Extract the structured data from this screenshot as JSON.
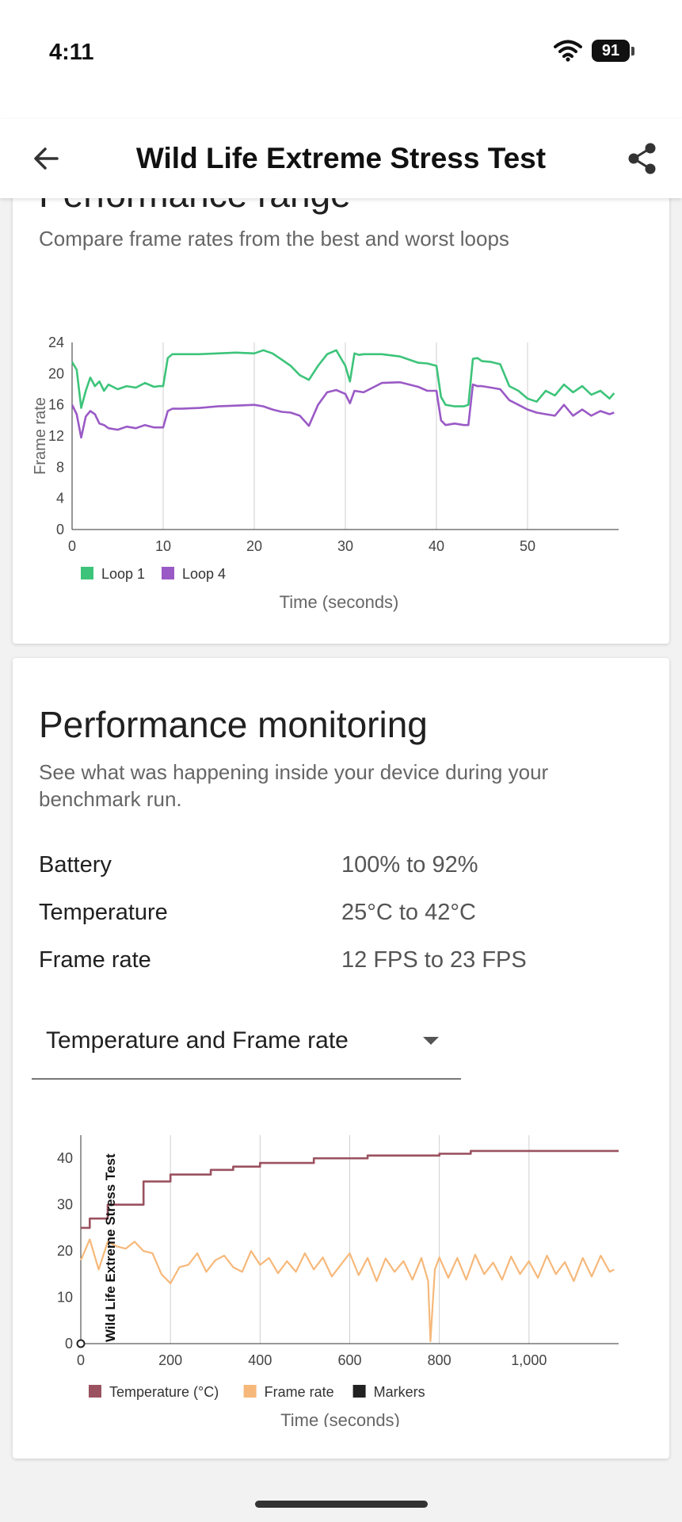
{
  "status_bar": {
    "time": "4:11",
    "battery": "91"
  },
  "app_bar": {
    "title": "Wild Life Extreme Stress Test"
  },
  "range_card": {
    "heading": "Performance range",
    "subtitle": "Compare frame rates from the best and worst loops"
  },
  "monitor_card": {
    "heading": "Performance monitoring",
    "subtitle": "See what was happening inside your device during your benchmark run.",
    "stats": [
      {
        "label": "Battery",
        "value": "100% to 92%"
      },
      {
        "label": "Temperature",
        "value": "25°C to 42°C"
      },
      {
        "label": "Frame rate",
        "value": "12 FPS to 23 FPS"
      }
    ],
    "dropdown": {
      "selected": "Temperature and Frame rate"
    }
  },
  "colors": {
    "loop1": "#3dc47a",
    "loop4": "#9a5ac6",
    "temperature": "#9b5260",
    "frame_rate": "#f6b87a",
    "markers": "#222222"
  },
  "chart_data": [
    {
      "type": "line",
      "xlabel": "Time (seconds)",
      "ylabel": "Frame rate",
      "xlim": [
        0,
        60
      ],
      "ylim": [
        0,
        24
      ],
      "x_ticks": [
        "0",
        "10",
        "20",
        "30",
        "40",
        "50"
      ],
      "y_ticks": [
        "0",
        "4",
        "8",
        "12",
        "16",
        "20",
        "24"
      ],
      "grid": "vertical",
      "legend": "bottom-left",
      "series": [
        {
          "name": "Loop 1",
          "x": [
            0,
            0.5,
            1,
            1.5,
            2,
            2.5,
            3,
            3.5,
            4,
            5,
            6,
            7,
            8,
            9,
            9.5,
            10,
            10.5,
            11,
            12,
            14,
            16,
            18,
            20,
            21,
            22,
            23,
            24,
            25,
            26,
            27,
            28,
            29,
            30,
            30.5,
            31,
            31.5,
            32,
            34,
            36,
            38,
            39,
            40,
            40.5,
            41,
            42,
            43,
            43.5,
            44,
            44.5,
            45,
            46,
            47,
            48,
            49,
            50,
            51,
            52,
            53,
            54,
            55,
            56,
            57,
            58,
            59,
            59.5
          ],
          "values": [
            21.5,
            20.5,
            15.6,
            17.8,
            19.5,
            18.4,
            19.0,
            17.8,
            18.6,
            18.0,
            18.4,
            18.2,
            18.8,
            18.3,
            18.4,
            18.4,
            22.0,
            22.5,
            22.5,
            22.5,
            22.6,
            22.7,
            22.6,
            23.0,
            22.6,
            21.8,
            21.0,
            19.8,
            19.2,
            21.0,
            22.5,
            23.0,
            21.0,
            19.0,
            22.6,
            22.4,
            22.5,
            22.5,
            22.2,
            21.4,
            21.3,
            21.0,
            17.0,
            16.0,
            15.8,
            15.8,
            16.0,
            21.9,
            22.0,
            21.6,
            21.5,
            21.2,
            18.4,
            17.8,
            16.8,
            16.4,
            17.8,
            17.2,
            18.6,
            17.6,
            18.4,
            17.3,
            17.8,
            16.8,
            17.5
          ]
        },
        {
          "name": "Loop 4",
          "x": [
            0,
            0.5,
            1,
            1.5,
            2,
            2.5,
            3,
            3.5,
            4,
            5,
            6,
            7,
            8,
            9,
            9.5,
            10,
            10.5,
            11,
            12,
            14,
            16,
            18,
            20,
            21,
            22,
            23,
            24,
            25,
            26,
            27,
            28,
            29,
            30,
            30.5,
            31,
            32,
            33,
            34,
            36,
            38,
            39,
            40,
            40.5,
            41,
            42,
            43,
            43.5,
            44,
            44.5,
            45,
            46,
            47,
            48,
            49,
            50,
            51,
            52,
            53,
            54,
            55,
            56,
            57,
            58,
            59,
            59.5
          ],
          "values": [
            16.0,
            14.8,
            11.8,
            14.5,
            15.2,
            14.8,
            13.6,
            13.4,
            13.0,
            12.8,
            13.2,
            13.0,
            13.4,
            13.1,
            13.1,
            13.1,
            15.2,
            15.5,
            15.5,
            15.6,
            15.8,
            15.9,
            16.0,
            15.8,
            15.4,
            15.1,
            15.0,
            14.6,
            13.3,
            16.0,
            17.6,
            17.9,
            17.4,
            16.2,
            17.8,
            17.6,
            18.2,
            18.8,
            18.9,
            18.3,
            17.8,
            17.8,
            14.0,
            13.4,
            13.6,
            13.4,
            13.4,
            18.6,
            18.4,
            18.4,
            18.2,
            18.0,
            16.6,
            16.0,
            15.4,
            15.0,
            14.8,
            14.6,
            16.0,
            14.6,
            15.4,
            14.6,
            15.2,
            14.8,
            15.0
          ]
        }
      ]
    },
    {
      "type": "line",
      "xlabel": "Time (seconds)",
      "xlim": [
        0,
        1200
      ],
      "ylim": [
        0,
        45
      ],
      "x_ticks": [
        "0",
        "200",
        "400",
        "600",
        "800",
        "1,000"
      ],
      "y_ticks": [
        "0",
        "10",
        "20",
        "30",
        "40"
      ],
      "y_axis_annotation": "Wild Life Extreme Stress Test",
      "grid": "vertical",
      "legend": "bottom-left",
      "series": [
        {
          "name": "Temperature (°C)",
          "x": [
            0,
            20,
            20,
            60,
            60,
            140,
            140,
            200,
            200,
            290,
            290,
            340,
            340,
            400,
            400,
            520,
            520,
            640,
            640,
            800,
            800,
            870,
            870,
            1200
          ],
          "values": [
            25,
            25,
            27,
            27,
            30,
            30,
            35,
            35,
            36.5,
            36.5,
            37.5,
            37.5,
            38.2,
            38.2,
            39,
            39,
            40,
            40,
            40.6,
            40.6,
            41,
            41,
            41.6,
            41.6
          ]
        },
        {
          "name": "Frame rate",
          "x": [
            0,
            20,
            40,
            60,
            80,
            100,
            120,
            140,
            160,
            180,
            200,
            220,
            240,
            260,
            280,
            300,
            320,
            340,
            360,
            380,
            400,
            420,
            440,
            460,
            480,
            500,
            520,
            540,
            560,
            580,
            600,
            620,
            640,
            660,
            680,
            700,
            720,
            740,
            760,
            775,
            780,
            790,
            800,
            820,
            840,
            860,
            880,
            900,
            920,
            940,
            960,
            980,
            1000,
            1020,
            1040,
            1060,
            1080,
            1100,
            1120,
            1140,
            1160,
            1180,
            1190
          ],
          "values": [
            18,
            22.5,
            16,
            22,
            21,
            20.5,
            22,
            20,
            19.5,
            15,
            13,
            16.5,
            17,
            19.5,
            15.5,
            18,
            19,
            16.5,
            15.5,
            20,
            17,
            18.5,
            15.2,
            17.8,
            15.5,
            19.5,
            16,
            18.6,
            14.5,
            17,
            19.5,
            14.8,
            18.5,
            13.5,
            18.4,
            15.5,
            17.8,
            13.8,
            18.5,
            13.5,
            0.5,
            16,
            18.6,
            14.2,
            18.5,
            13.8,
            19.2,
            15,
            17.5,
            13.8,
            18.8,
            15,
            17.8,
            14.2,
            19,
            15,
            17.6,
            13.5,
            18.5,
            14.5,
            19,
            15.5,
            16
          ]
        },
        {
          "name": "Markers",
          "x": [
            0
          ],
          "values": [
            0
          ]
        }
      ]
    }
  ]
}
